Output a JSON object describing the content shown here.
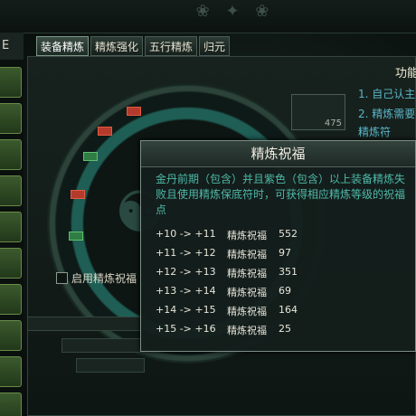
{
  "left_panel": {
    "header": "E"
  },
  "tabs": [
    {
      "label": "装备精炼",
      "active": true
    },
    {
      "label": "精炼强化",
      "active": false
    },
    {
      "label": "五行精炼",
      "active": false
    },
    {
      "label": "归元",
      "active": false
    }
  ],
  "right_panel": {
    "title": "功能",
    "lines": [
      "1. 自己认主",
      "2. 精炼需要",
      "精炼符"
    ]
  },
  "item_slot": {
    "count": "475"
  },
  "options": {
    "checkbox_label": "启用精炼祝福",
    "checked": false
  },
  "popup": {
    "title": "精炼祝福",
    "description": "金丹前期（包含）并且紫色（包含）以上装备精炼失败且使用精炼保底符时，可获得相应精炼等级的祝福点",
    "rows": [
      {
        "range": "+10 -> +11",
        "label": "精炼祝福",
        "value": "552"
      },
      {
        "range": "+11 -> +12",
        "label": "精炼祝福",
        "value": "97"
      },
      {
        "range": "+12 -> +13",
        "label": "精炼祝福",
        "value": "351"
      },
      {
        "range": "+13 -> +14",
        "label": "精炼祝福",
        "value": "69"
      },
      {
        "range": "+14 -> +15",
        "label": "精炼祝福",
        "value": "164"
      },
      {
        "range": "+15 -> +16",
        "label": "精炼祝福",
        "value": "25"
      }
    ]
  },
  "colors": {
    "accent_text": "#4fb9a8",
    "ring": "#1f5e55",
    "side_button": "#3b5a2d"
  }
}
